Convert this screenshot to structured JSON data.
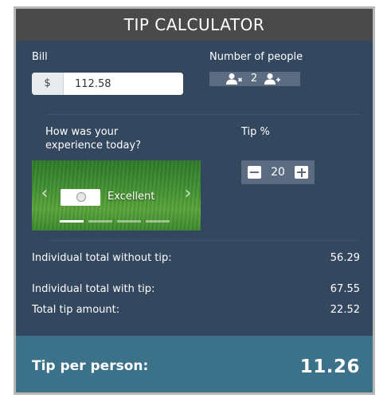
{
  "title": "TIP CALCULATOR",
  "bill": {
    "label": "Bill",
    "currency_symbol": "$",
    "value": "112.58"
  },
  "people": {
    "label": "Number of people",
    "value": "2",
    "decrease_icon": "remove-person-icon",
    "increase_icon": "add-person-icon"
  },
  "experience": {
    "question": "How was your experience today?",
    "selected_label": "Excellent",
    "slide_count": 4,
    "active_slide": 1
  },
  "tip": {
    "label": "Tip %",
    "value": "20"
  },
  "summary": {
    "without_tip_label": "Individual total without tip:",
    "without_tip_value": "56.29",
    "with_tip_label": "Individual total with tip:",
    "with_tip_value": "67.55",
    "total_tip_label": "Total tip amount:",
    "total_tip_value": "22.52"
  },
  "footer": {
    "label": "Tip per person:",
    "value": "11.26"
  },
  "colors": {
    "panel": "#33475f",
    "header": "#4a4a4a",
    "footer": "#3b7189",
    "stepper": "#5b6c80"
  }
}
